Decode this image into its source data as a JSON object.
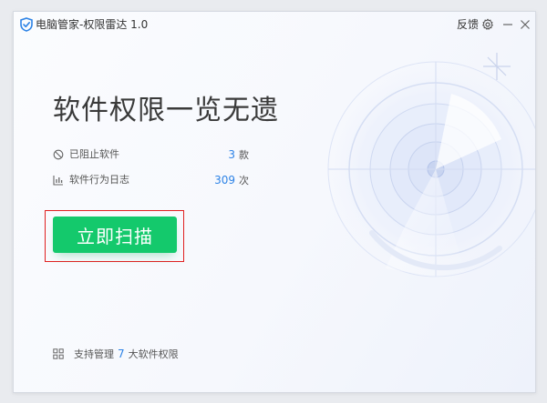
{
  "titlebar": {
    "title": "电脑管家-权限雷达 1.0",
    "feedback_label": "反馈",
    "icons": [
      "shield-logo-icon",
      "gear-icon",
      "minimize-icon",
      "close-icon"
    ]
  },
  "main": {
    "headline": "软件权限一览无遗",
    "stats": [
      {
        "label": "已阻止软件",
        "value": "3",
        "unit": "款",
        "icon": "blocked-icon"
      },
      {
        "label": "软件行为日志",
        "value": "309",
        "unit": "次",
        "icon": "bar-chart-icon"
      }
    ],
    "scan_button_label": "立即扫描"
  },
  "footer": {
    "prefix": "支持管理",
    "count": "7",
    "suffix": "大软件权限",
    "icon": "grid-icon"
  },
  "colors": {
    "accent_green": "#14c96c",
    "accent_blue": "#2d83e6",
    "highlight_red": "#e02020",
    "text_dark": "#3a3a3a"
  }
}
